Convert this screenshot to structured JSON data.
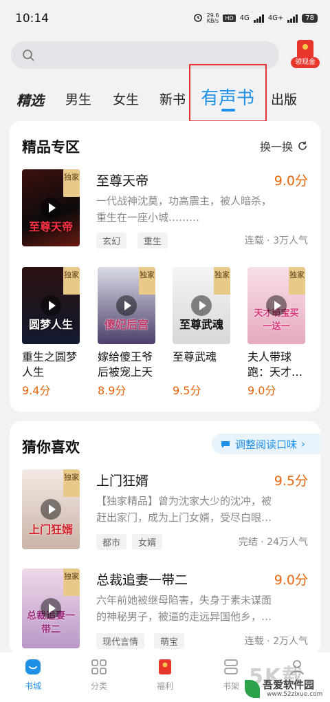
{
  "status_bar": {
    "time": "10:14",
    "net_speed_top": "29.6",
    "net_speed_bottom": "KB/s",
    "hd": "HD",
    "sim1": "4G",
    "sim2": "4G+",
    "battery": "78"
  },
  "search": {
    "placeholder": ""
  },
  "red_packet": {
    "label": "领现金"
  },
  "tabs": [
    {
      "label": "精选"
    },
    {
      "label": "男生"
    },
    {
      "label": "女生"
    },
    {
      "label": "新书"
    },
    {
      "label": "有声书",
      "active": true
    },
    {
      "label": "出版"
    }
  ],
  "premium": {
    "title": "精品专区",
    "refresh_label": "换一换",
    "featured": {
      "cover_title": "至尊天帝",
      "badge": "独家",
      "title": "至尊天帝",
      "score": "9.0分",
      "desc_line1": "一代战神沈莫，功高震主，被人暗杀，",
      "desc_line2": "重生在一座小城………",
      "tags": [
        "玄幻",
        "重生"
      ],
      "status": "连载",
      "popularity": "3万人气"
    },
    "grid": [
      {
        "title_line1": "重生之圆梦",
        "title_line2": "人生",
        "score": "9.4分",
        "badge": "独家",
        "cover_title": "圆梦人生"
      },
      {
        "title_line1": "嫁给傻王爷",
        "title_line2": "后被宠上天",
        "score": "8.9分",
        "badge": "独家",
        "cover_title": "傻妃后宫"
      },
      {
        "title_line1": "至尊武魂",
        "title_line2": "",
        "score": "9.5分",
        "badge": "独家",
        "cover_title": "至尊武魂"
      },
      {
        "title_line1": "夫人带球",
        "title_line2": "跑：天才…",
        "score": "9.0分",
        "badge": "独家",
        "cover_title": "天才萌宝买一送一"
      }
    ]
  },
  "guess": {
    "title": "猜你喜欢",
    "adjust_label": "调整阅读口味",
    "books": [
      {
        "cover_title": "上门狂婿",
        "badge": "独家",
        "title": "上门狂婿",
        "score": "9.5分",
        "desc_line1": "【独家精品】曾为沈家大少的沈冲，被",
        "desc_line2": "赶出家门，成为上门女婿，受尽白眼…",
        "tags": [
          "都市",
          "女婿"
        ],
        "status": "完结",
        "popularity": "24万人气"
      },
      {
        "cover_title": "总裁追妻一带二",
        "badge": "独家",
        "title": "总裁追妻一带二",
        "score": "9.0分",
        "desc_line1": "六年前她被继母陷害，失身于素未谋面",
        "desc_line2": "的神秘男子，被逼的走远异国他乡，…",
        "tags": [
          "现代言情",
          "萌宝"
        ],
        "status": "连载",
        "popularity": "2万人气"
      }
    ]
  },
  "bottom_nav": [
    {
      "label": "书城",
      "active": true
    },
    {
      "label": "分类"
    },
    {
      "label": "福利"
    },
    {
      "label": "书架"
    },
    {
      "label": ""
    }
  ],
  "watermark": {
    "brand": "吾爱软件园",
    "url": "www.52zixue.com"
  },
  "colors": {
    "accent": "#1e90e6",
    "score": "#e8650c",
    "highlight_box": "#e53030"
  }
}
